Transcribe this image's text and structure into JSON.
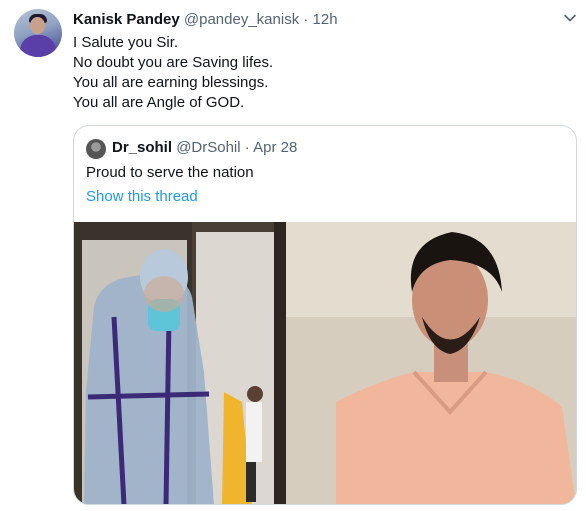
{
  "tweet": {
    "author_name": "Kanisk Pandey",
    "author_handle": "@pandey_kanisk",
    "separator": "·",
    "time": "12h",
    "text_lines": [
      "I Salute you Sir.",
      "No doubt you are Saving lifes.",
      "You all are earning blessings.",
      "You all are Angle of GOD."
    ]
  },
  "quoted_tweet": {
    "author_name": "Dr_sohil",
    "author_handle": "@DrSohil",
    "separator": "·",
    "date": "Apr 28",
    "text": "Proud to serve the nation",
    "thread_link": "Show this thread"
  },
  "icons": {
    "more_menu": "chevron-down-icon"
  },
  "colors": {
    "link": "#1d9bf0",
    "secondary_text": "#536471",
    "border": "#cfd9de"
  }
}
